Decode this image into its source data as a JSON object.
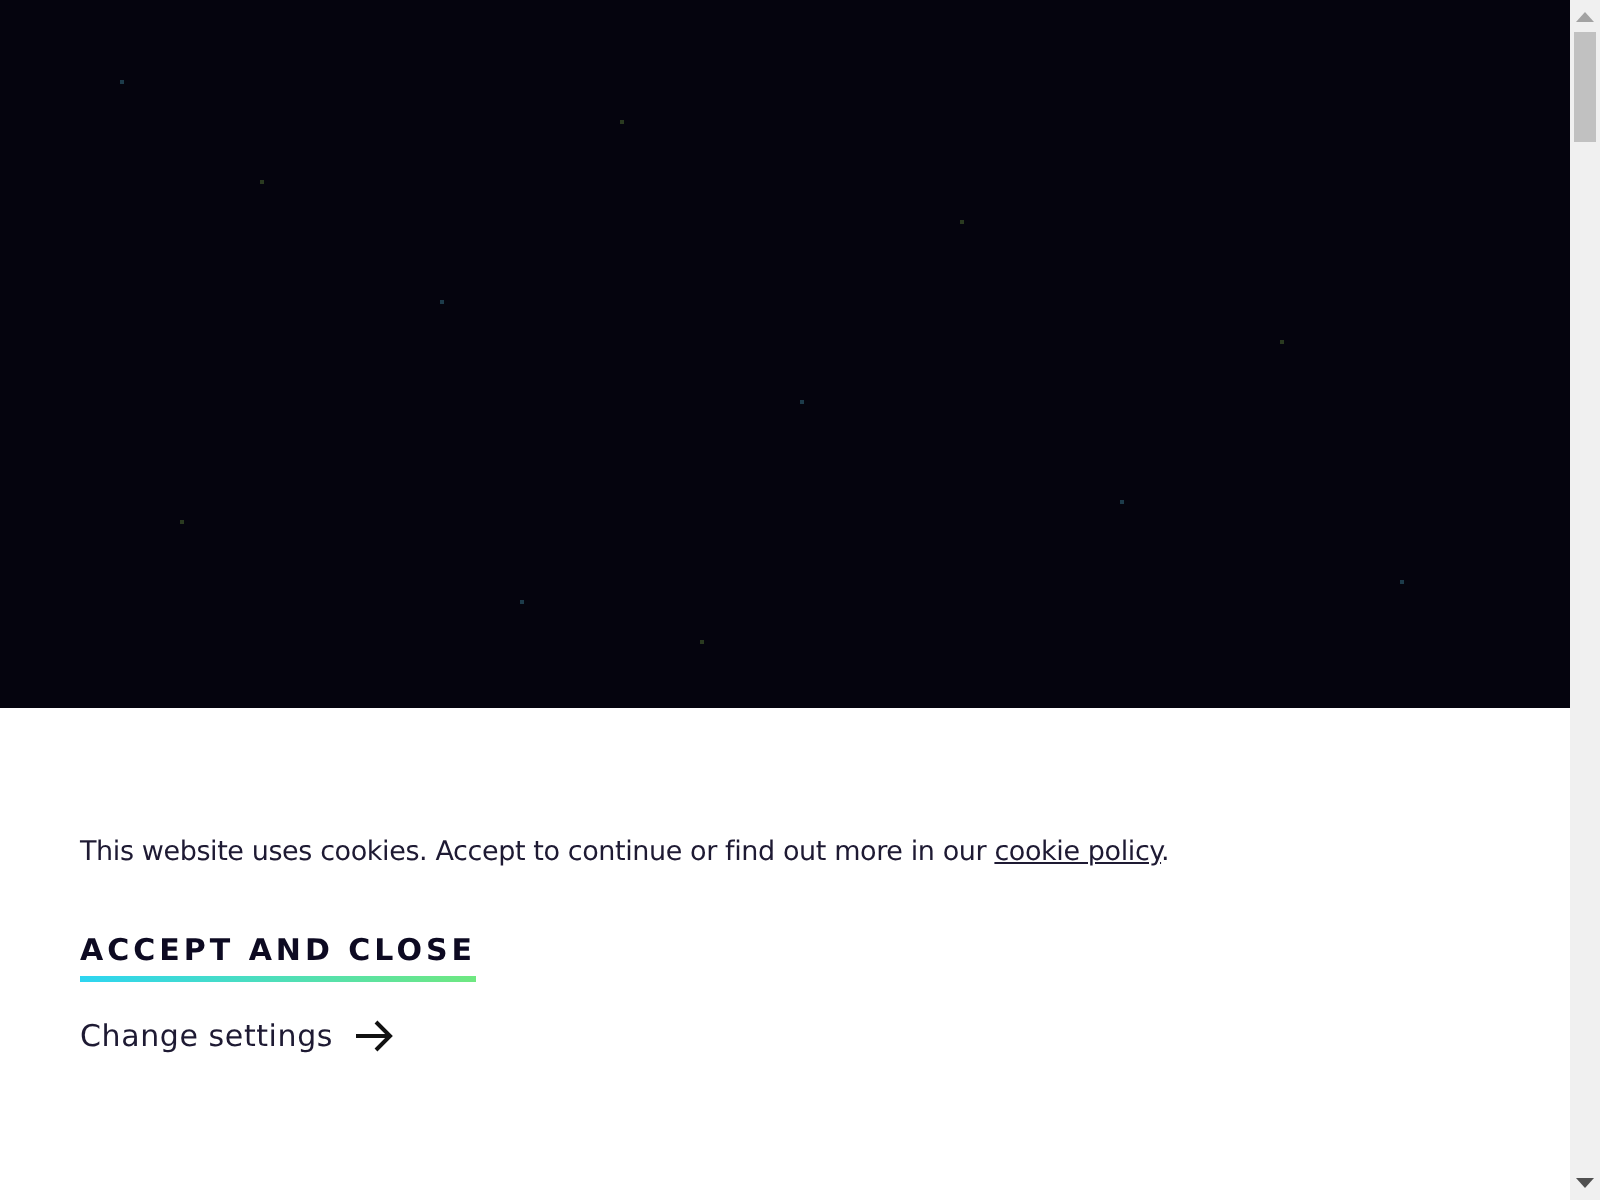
{
  "cookie_banner": {
    "message": "This website uses cookies. Accept to continue or find out more in our ",
    "link": "cookie policy",
    "message_end": ".",
    "accept_button": "ACCEPT AND CLOSE",
    "settings_link": "Change settings"
  }
}
